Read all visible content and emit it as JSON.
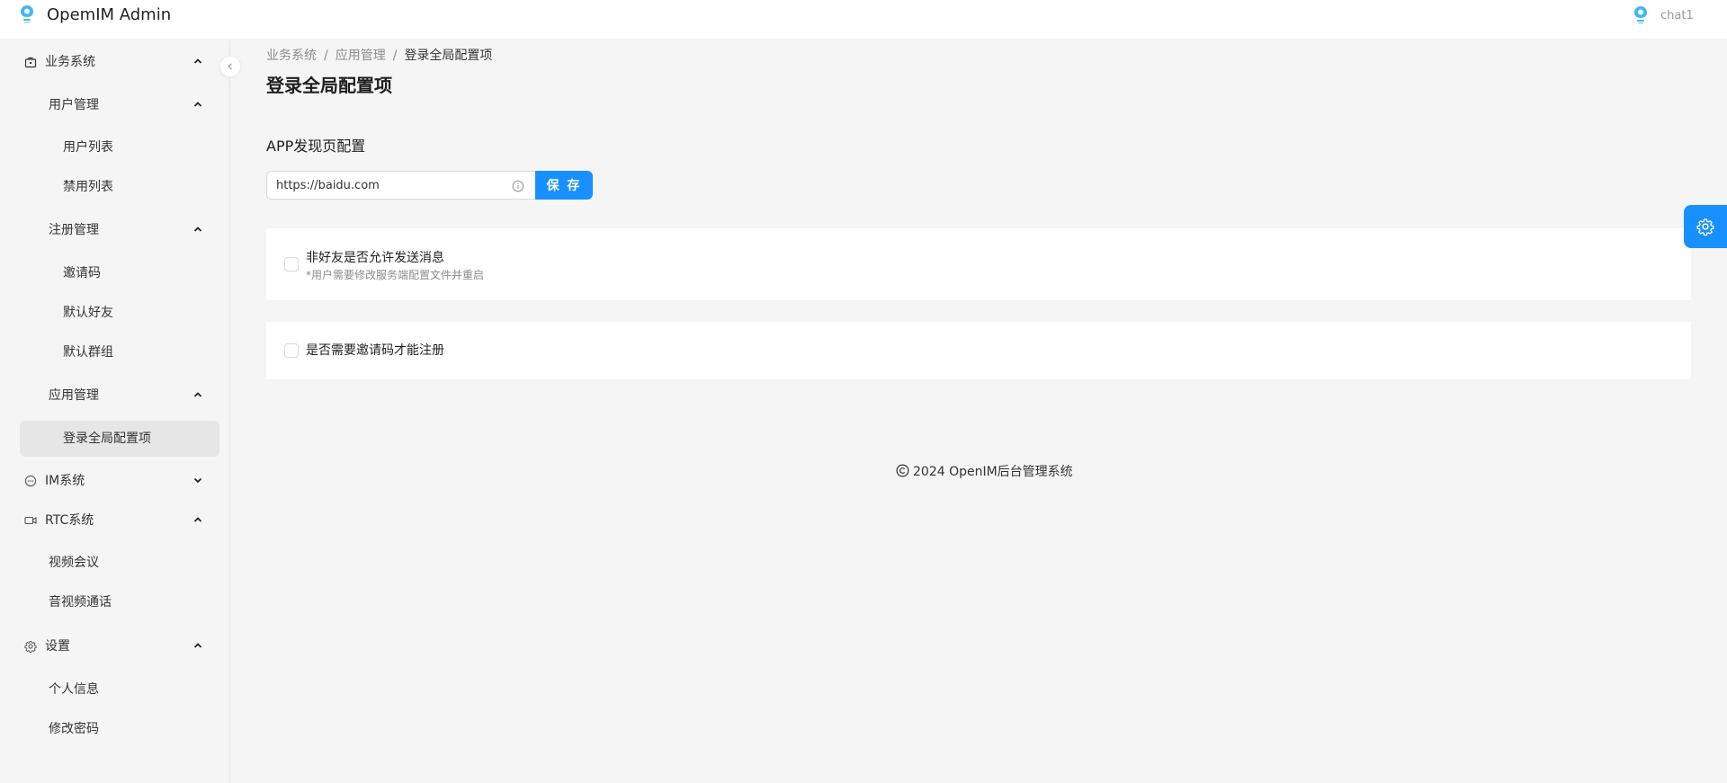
{
  "header": {
    "app_title": "OpemIM Admin",
    "user_name": "chat1"
  },
  "sidebar": {
    "items": [
      {
        "label": "业务系统",
        "icon": "briefcase-icon",
        "level": 0,
        "chevron": "up"
      },
      {
        "label": "用户管理",
        "level": 1,
        "chevron": "up"
      },
      {
        "label": "用户列表",
        "level": 2
      },
      {
        "label": "禁用列表",
        "level": 2
      },
      {
        "label": "注册管理",
        "level": 1,
        "chevron": "up"
      },
      {
        "label": "邀请码",
        "level": 2
      },
      {
        "label": "默认好友",
        "level": 2
      },
      {
        "label": "默认群组",
        "level": 2
      },
      {
        "label": "应用管理",
        "level": 1,
        "chevron": "up"
      },
      {
        "label": "登录全局配置项",
        "level": 2,
        "active": true
      },
      {
        "label": "IM系统",
        "icon": "chat-bubble-icon",
        "level": 0,
        "chevron": "down"
      },
      {
        "label": "RTC系统",
        "icon": "video-camera-icon",
        "level": 0,
        "chevron": "up"
      },
      {
        "label": "视频会议",
        "level": 1
      },
      {
        "label": "音视频通话",
        "level": 1
      },
      {
        "label": "设置",
        "icon": "gear-icon",
        "level": 0,
        "chevron": "up"
      },
      {
        "label": "个人信息",
        "level": 1
      },
      {
        "label": "修改密码",
        "level": 1
      }
    ]
  },
  "breadcrumb": {
    "items": [
      "业务系统",
      "应用管理",
      "登录全局配置项"
    ],
    "separator": "/"
  },
  "page": {
    "title": "登录全局配置项"
  },
  "app_discover": {
    "section_title": "APP发现页配置",
    "url_value": "https://baidu.com",
    "save_label": "保 存"
  },
  "options": [
    {
      "label": "非好友是否允许发送消息",
      "hint": "*用户需要修改服务端配置文件并重启",
      "checked": false
    },
    {
      "label": "是否需要邀请码才能注册",
      "checked": false
    }
  ],
  "footer": {
    "text": "2024 OpenIM后台管理系统"
  },
  "colors": {
    "primary": "#1890ff",
    "active_menu_bg": "#e6e6e6",
    "page_bg": "#f5f5f5"
  }
}
